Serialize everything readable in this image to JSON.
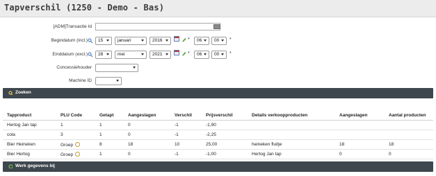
{
  "title": "Tapverschil (1250 - Demo - Bas)",
  "form": {
    "transactie_label": "[ADM]Transactie Id",
    "transactie_value": "",
    "begin_label": "Begindatum (incl.)",
    "begin_day": "15",
    "begin_month": "januari",
    "begin_year": "2016",
    "begin_hour": "06",
    "begin_minute": "00",
    "eind_label": "Einddatum (excl.)",
    "eind_day": "28",
    "eind_month": "mei",
    "eind_year": "2021",
    "eind_hour": "06",
    "eind_minute": "00",
    "required_mark": "*",
    "concessie_label": "Concessiehouder",
    "concessie_value": "",
    "machine_label": "Machine ID",
    "machine_value": ""
  },
  "search_bar": {
    "label": "Zoeken"
  },
  "bottom_bar": {
    "label": "Werk gegevens bij"
  },
  "table": {
    "headers": [
      "Tapproduct",
      "PLU Code",
      "Getapt",
      "Aangeslagen",
      "Verschil",
      "Prijsverschil",
      "Details verkoopproducten",
      "Aangeslagen",
      "Aantal producten"
    ],
    "rows": [
      [
        "Hertog Jan tap",
        "1",
        "1",
        "0",
        "-1",
        "-1,90",
        "",
        "",
        ""
      ],
      [
        "cola",
        "3",
        "1",
        "0",
        "-1",
        "-2,25",
        "",
        "",
        ""
      ],
      [
        "Bier Heineken",
        "Groep",
        "8",
        "18",
        "10",
        "25,00",
        "heineken fluitje",
        "18",
        "18"
      ],
      [
        "Bier Hertog",
        "Groep",
        "1",
        "0",
        "-1",
        "-1,00",
        "Hertog Jan tap",
        "0",
        "0"
      ]
    ]
  },
  "colors": {
    "bar": "#3e474d",
    "titlebar": "#ececec"
  }
}
